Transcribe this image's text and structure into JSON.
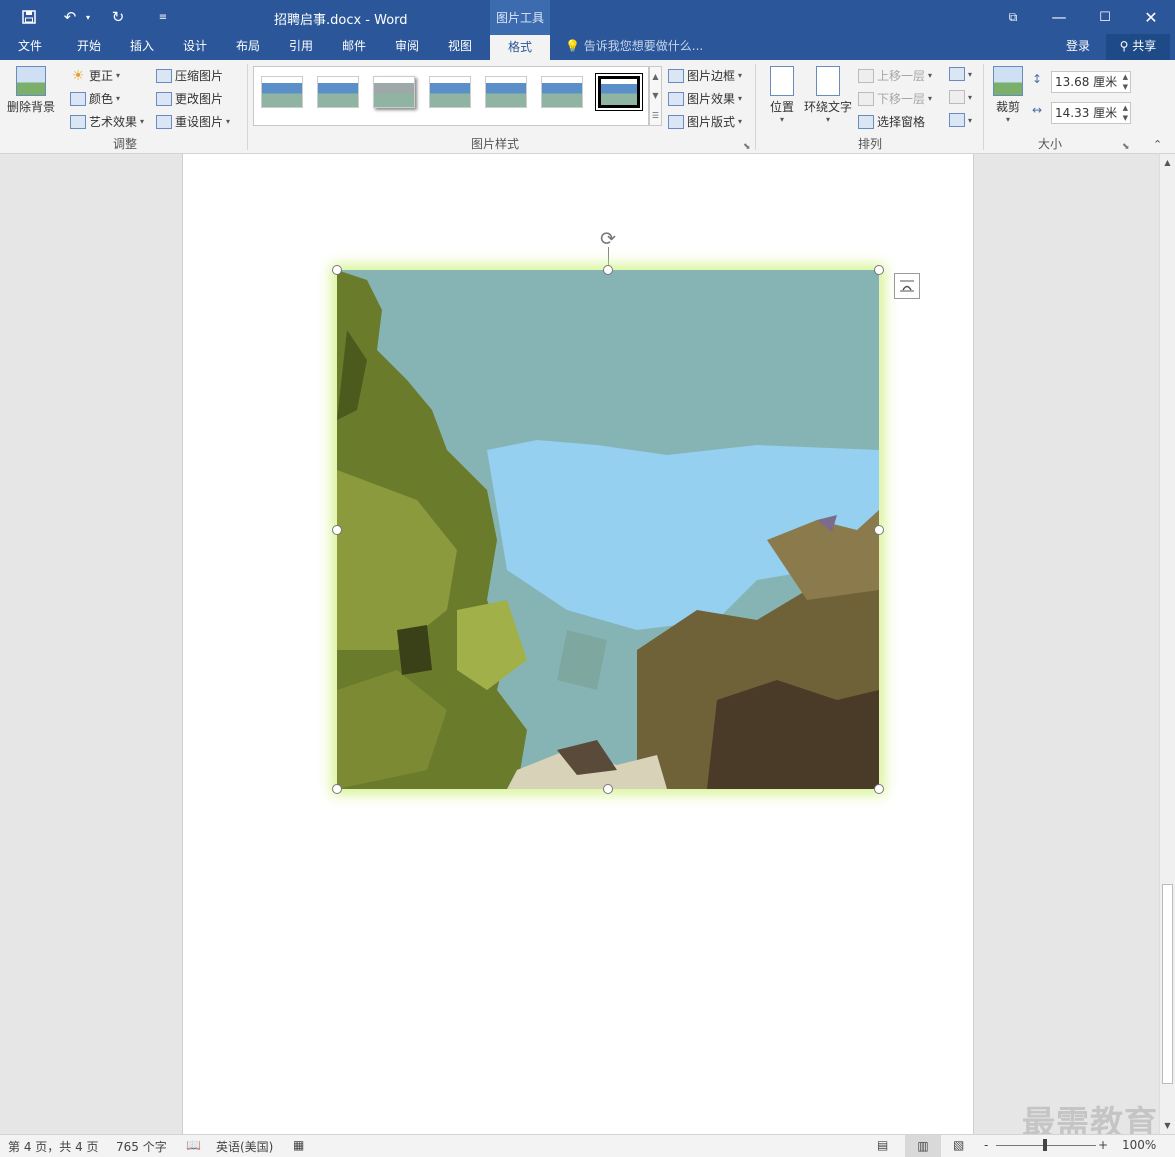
{
  "window": {
    "title": "招聘启事.docx - Word",
    "context_tools_label": "图片工具",
    "quick_access": {
      "customize_icon": "customize-qat-icon"
    }
  },
  "tabs": [
    {
      "label": "文件"
    },
    {
      "label": "开始"
    },
    {
      "label": "插入"
    },
    {
      "label": "设计"
    },
    {
      "label": "布局"
    },
    {
      "label": "引用"
    },
    {
      "label": "邮件"
    },
    {
      "label": "审阅"
    },
    {
      "label": "视图"
    },
    {
      "label": "格式",
      "active": true
    }
  ],
  "tell_me": {
    "placeholder": "告诉我您想要做什么..."
  },
  "account": {
    "login": "登录",
    "share": "共享"
  },
  "ribbon": {
    "adjust": {
      "remove_bg": "删除背景",
      "corrections": "更正",
      "color": "颜色",
      "artistic": "艺术效果",
      "compress": "压缩图片",
      "change": "更改图片",
      "reset": "重设图片",
      "group_label": "调整"
    },
    "styles": {
      "border": "图片边框",
      "effects": "图片效果",
      "layout": "图片版式",
      "group_label": "图片样式"
    },
    "arrange": {
      "position": "位置",
      "wrap": "环绕文字",
      "forward": "上移一层",
      "backward": "下移一层",
      "selection_pane": "选择窗格",
      "group_label": "排列"
    },
    "size": {
      "crop": "裁剪",
      "height": "13.68 厘米",
      "width": "14.33 厘米",
      "group_label": "大小"
    }
  },
  "status": {
    "page": "第 4 页，共 4 页",
    "words": "765 个字",
    "language": "英语(美国)",
    "zoom": "100%",
    "zoom_minus": "-",
    "zoom_plus": "+"
  },
  "watermark": "最需教育",
  "colors": {
    "titlebar": "#2b579a",
    "glow": "#cdf078",
    "sky_dark": "#86b4b4",
    "sky_light": "#95d0f1",
    "foliage": "#6b7b2c"
  }
}
